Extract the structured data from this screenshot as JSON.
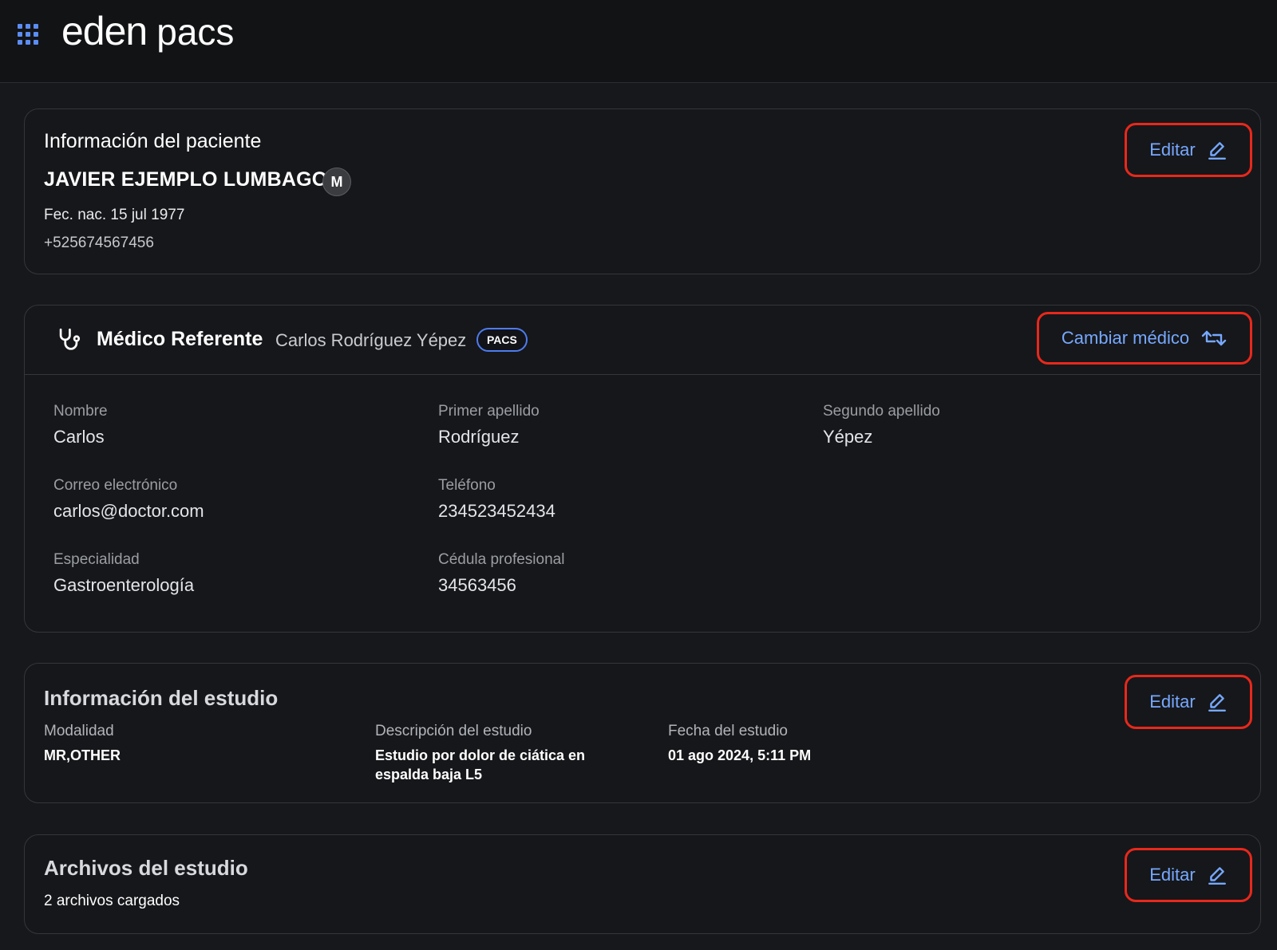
{
  "header": {
    "logo_primary": "eden",
    "logo_secondary": "pacs",
    "accent_color": "#3b82f6"
  },
  "patient": {
    "section_title": "Información del paciente",
    "name": "JAVIER EJEMPLO LUMBAGO",
    "sex": "M",
    "birth_date": "Fec. nac. 15 jul 1977",
    "phone": "+525674567456",
    "edit_label": "Editar"
  },
  "referring": {
    "title": "Médico Referente",
    "doctor_name": "Carlos Rodríguez Yépez",
    "badge": "PACS",
    "change_label": "Cambiar médico",
    "fields": {
      "nombre": {
        "label": "Nombre",
        "value": "Carlos"
      },
      "primer_apellido": {
        "label": "Primer apellido",
        "value": "Rodríguez"
      },
      "segundo_apellido": {
        "label": "Segundo apellido",
        "value": "Yépez"
      },
      "correo": {
        "label": "Correo electrónico",
        "value": "carlos@doctor.com"
      },
      "telefono": {
        "label": "Teléfono",
        "value": "234523452434"
      },
      "especialidad": {
        "label": "Especialidad",
        "value": "Gastroenterología"
      },
      "cedula": {
        "label": "Cédula profesional",
        "value": "34563456"
      }
    }
  },
  "study": {
    "section_title": "Información del estudio",
    "edit_label": "Editar",
    "modalidad_label": "Modalidad",
    "modalidad_value": "MR,OTHER",
    "descripcion_label": "Descripción del estudio",
    "descripcion_line1": "Estudio por dolor de ciática en",
    "descripcion_line2": "espalda baja L5",
    "fecha_label": "Fecha del estudio",
    "fecha_value": "01 ago 2024, 5:11 PM"
  },
  "files": {
    "section_title": "Archivos del estudio",
    "edit_label": "Editar",
    "count_text": "2 archivos cargados"
  },
  "icons": {
    "apps": "apps-grid-icon",
    "edit": "pencil-icon",
    "swap": "swap-arrows-icon",
    "stethoscope": "stethoscope-icon"
  }
}
